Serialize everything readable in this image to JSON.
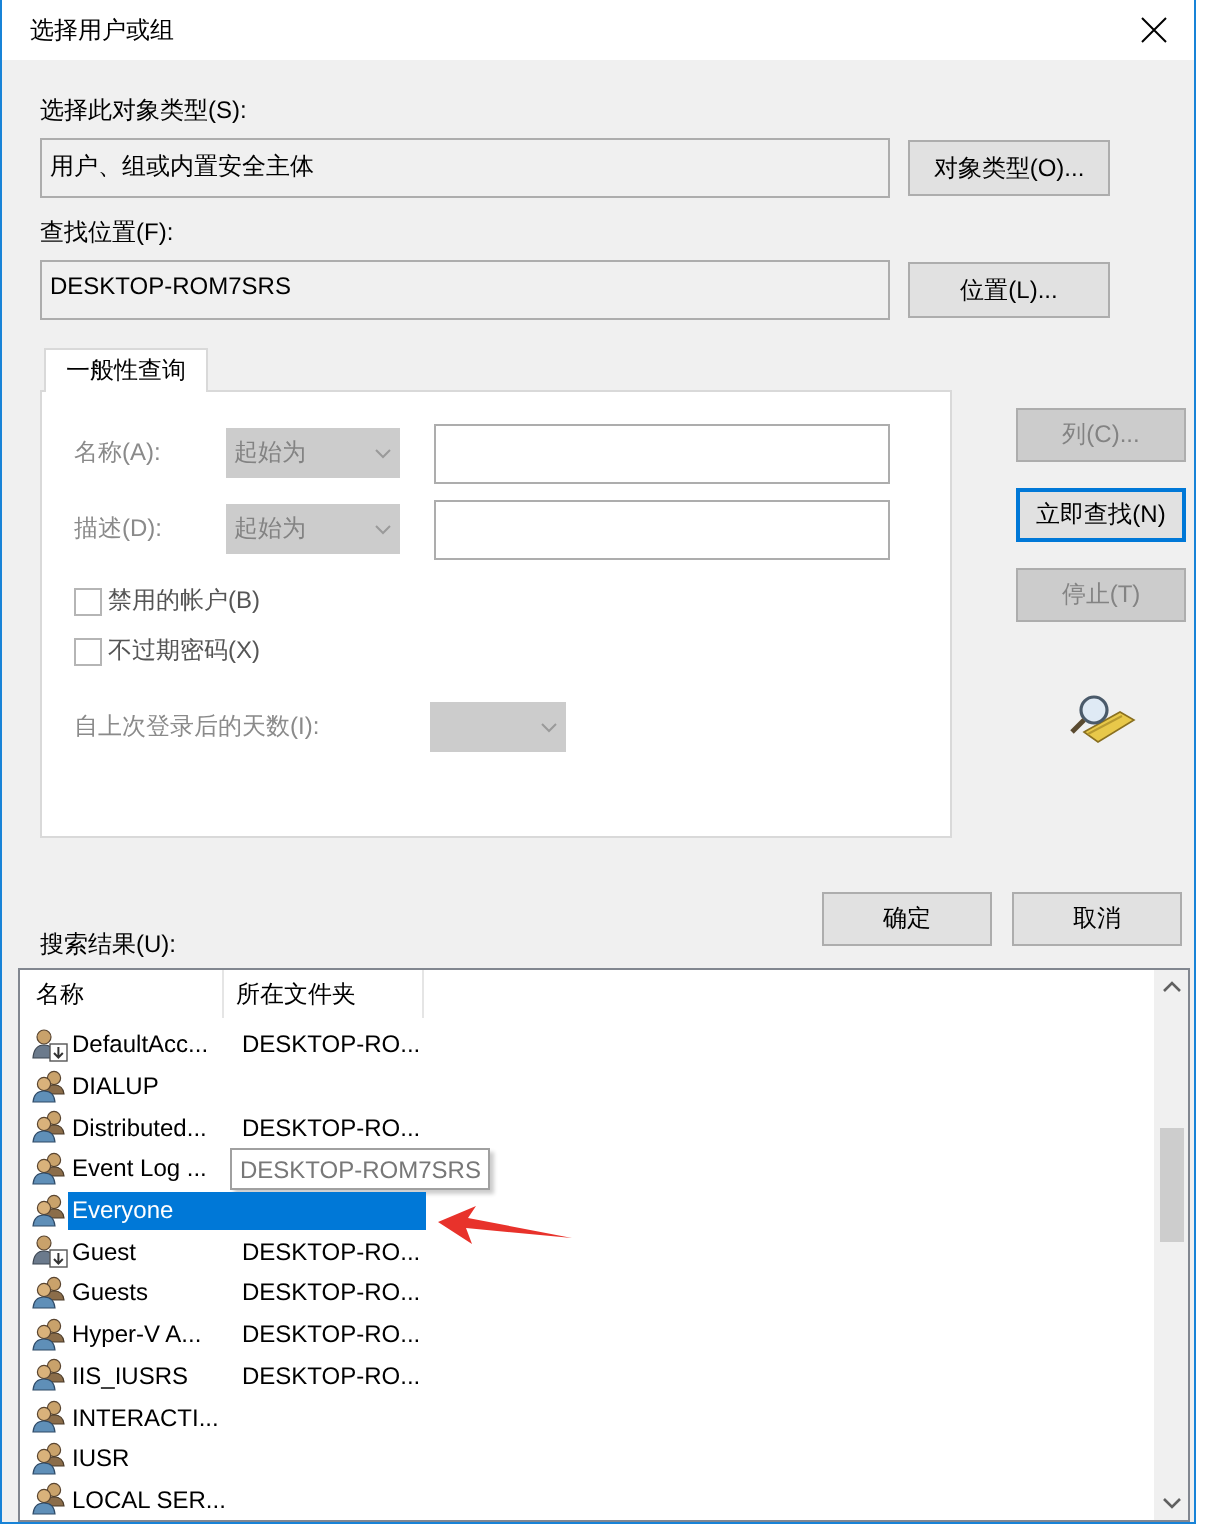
{
  "window": {
    "title": "选择用户或组"
  },
  "object_type": {
    "label": "选择此对象类型(S):",
    "value": "用户、组或内置安全主体",
    "button": "对象类型(O)..."
  },
  "location": {
    "label": "查找位置(F):",
    "value": "DESKTOP-ROM7SRS",
    "button": "位置(L)..."
  },
  "tabs": [
    {
      "label": "一般性查询",
      "selected": true
    }
  ],
  "query": {
    "fields": [
      {
        "label": "名称(A):",
        "operator": "起始为",
        "disabled": true
      },
      {
        "label": "描述(D):",
        "operator": "起始为",
        "disabled": true
      }
    ],
    "checkboxes": [
      {
        "label": "禁用的帐户(B)",
        "checked": false
      },
      {
        "label": "不过期密码(X)",
        "checked": false
      }
    ],
    "days": {
      "label": "自上次登录后的天数(I):",
      "disabled": true
    }
  },
  "side_buttons": [
    {
      "label": "列(C)...",
      "disabled": true,
      "focused": false
    },
    {
      "label": "立即查找(N)",
      "disabled": false,
      "focused": true
    },
    {
      "label": "停止(T)",
      "disabled": true,
      "focused": false
    }
  ],
  "dialog_buttons": [
    "确定",
    "取消"
  ],
  "results": {
    "label": "搜索结果(U):",
    "columns": [
      "名称",
      "所在文件夹"
    ],
    "rows": [
      {
        "kind": "user",
        "name": "DefaultAcc...",
        "folder": "DESKTOP-RO...",
        "selected": false
      },
      {
        "kind": "group",
        "name": "DIALUP",
        "selected": false
      },
      {
        "kind": "group",
        "name": "Distributed...",
        "folder": "DESKTOP-RO...",
        "selected": false
      },
      {
        "kind": "group",
        "name": "Event Log ...",
        "tooltip": "DESKTOP-ROM7SRS",
        "selected": false
      },
      {
        "kind": "group",
        "name": "Everyone",
        "selected": true
      },
      {
        "kind": "user",
        "name": "Guest",
        "folder": "DESKTOP-RO...",
        "selected": false
      },
      {
        "kind": "group",
        "name": "Guests",
        "folder": "DESKTOP-RO...",
        "selected": false
      },
      {
        "kind": "group",
        "name": "Hyper-V A...",
        "folder": "DESKTOP-RO...",
        "selected": false
      },
      {
        "kind": "group",
        "name": "IIS_IUSRS",
        "folder": "DESKTOP-RO...",
        "selected": false
      },
      {
        "kind": "group",
        "name": "INTERACTI...",
        "selected": false
      },
      {
        "kind": "group",
        "name": "IUSR",
        "selected": false
      },
      {
        "kind": "group",
        "name": "LOCAL SER...",
        "selected": false
      }
    ]
  }
}
